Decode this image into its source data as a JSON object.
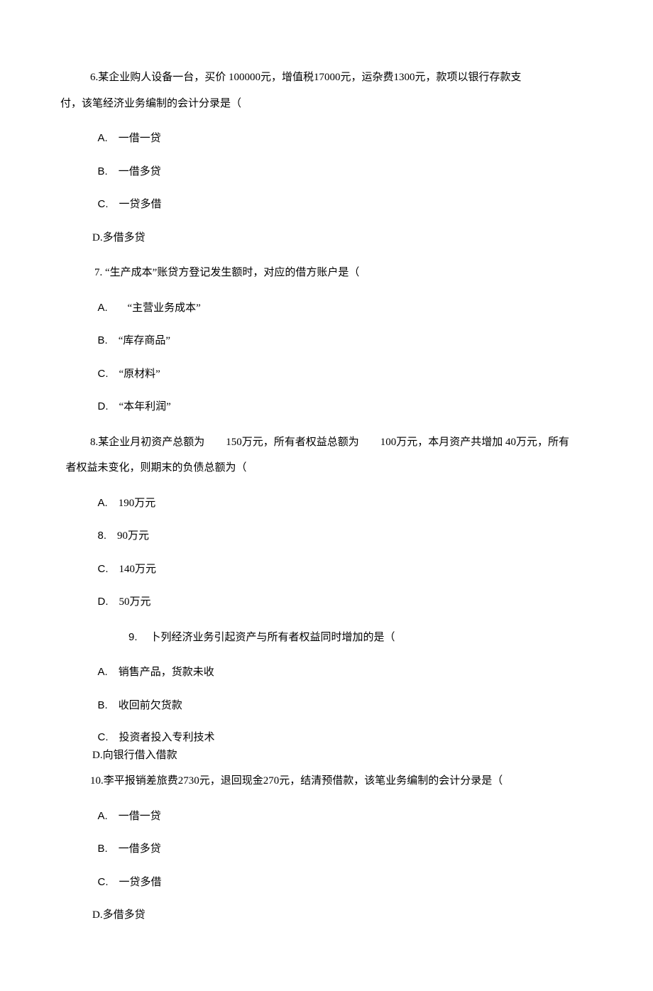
{
  "q6": {
    "stem_line1": "6.某企业购人设备一台，买价 100000元，增值税17000元，运杂费1300元，款项以银行存款支",
    "stem_line2": "付，该笔经济业务编制的会计分录是（",
    "A": "一借一贷",
    "B": "一借多贷",
    "C": "一贷多借",
    "D": "D.多借多贷"
  },
  "q7": {
    "stem": "7.  “生产成本”账贷方登记发生额时，对应的借方账户是（",
    "A": " “主营业务成本”",
    "B": "“库存商品”",
    "C": "“原材料”",
    "D": "“本年利润”"
  },
  "q8": {
    "stem_line1_a": "8.某企业月初资产总额为",
    "stem_line1_b": "150万元，所有者权益总额为",
    "stem_line1_c": "100万元，本月资产共增加 40万元，所有",
    "stem_line2": "者权益未变化，则期末的负债总额为（",
    "A": "190万元",
    "B_label": "8.",
    "B": "90万元",
    "C": "140万元",
    "D": "50万元"
  },
  "q9": {
    "stem": "卜列经济业务引起资产与所有者权益同时增加的是（",
    "stem_label": "9.",
    "A": "销售产品，货款未收",
    "B": "收回前欠货款",
    "C": "投资者投入专利技术",
    "D": "D.向银行借入借款"
  },
  "q10": {
    "stem": "10.李平报销差旅费2730元，退回现金270元，结清预借款，该笔业务编制的会计分录是（",
    "A": "一借一贷",
    "B": "一借多贷",
    "C": "一贷多借",
    "D": "D.多借多贷"
  },
  "labels": {
    "A": "A.",
    "B": "B.",
    "C": "C.",
    "D": "D."
  }
}
